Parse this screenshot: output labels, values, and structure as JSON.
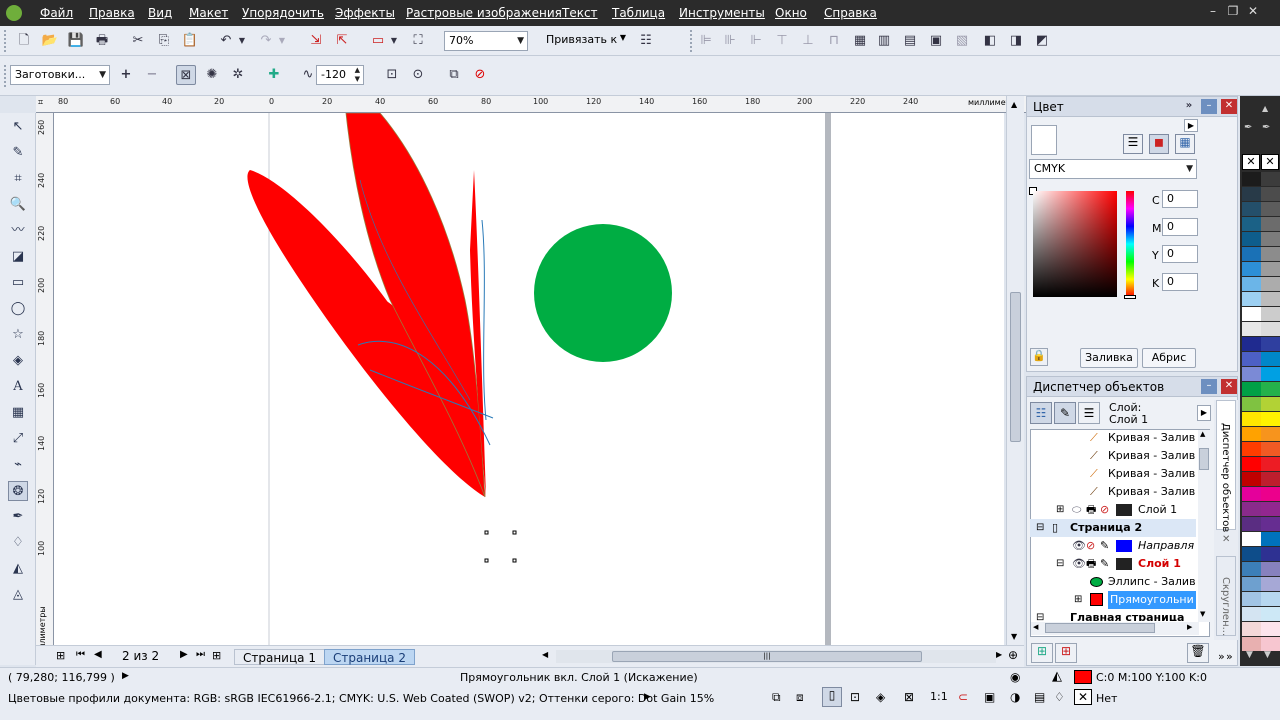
{
  "menu": [
    "Файл",
    "Правка",
    "Вид",
    "Макет",
    "Упорядочить",
    "Эффекты",
    "Растровые изображения",
    "Текст",
    "Таблица",
    "Инструменты",
    "Окно",
    "Справка"
  ],
  "window_controls": {
    "minimize": "–",
    "restore": "❐",
    "close": "✕"
  },
  "toolbar1": {
    "zoom_value": "70%",
    "snap_label": "Привязать к"
  },
  "toolbar2": {
    "presets_label": "Заготовки...",
    "distortion_value": "-120"
  },
  "ruler": {
    "unit": "миллиметры",
    "top_ticks": [
      "80",
      "60",
      "40",
      "20",
      "0",
      "20",
      "40",
      "60",
      "80",
      "100",
      "120",
      "140",
      "160",
      "180",
      "200",
      "220",
      "240"
    ],
    "left_ticks": [
      "260",
      "240",
      "220",
      "200",
      "180",
      "160",
      "140",
      "120",
      "100"
    ]
  },
  "pages": {
    "count_label": "2 из 2",
    "tabs": [
      "Страница 1",
      "Страница 2"
    ],
    "active_tab": 1
  },
  "status": {
    "coords": "( 79,280; 116,799 )",
    "selection": "Прямоугольник вкл. Слой 1  (Искажение)",
    "color_profiles": "Цветовые профили документа: RGB: sRGB IEC61966-2.1; CMYK: U.S. Web Coated (SWOP) v2; Оттенки серого: Dot Gain 15%",
    "fill_info": "C:0 M:100 Y:100 K:0",
    "outline_info": "Нет",
    "fill_color": "#ff0000"
  },
  "color_docker": {
    "title": "Цвет",
    "model": "CMYK",
    "channels": [
      {
        "label": "C",
        "value": "0"
      },
      {
        "label": "M",
        "value": "0"
      },
      {
        "label": "Y",
        "value": "0"
      },
      {
        "label": "K",
        "value": "0"
      }
    ],
    "fill_button": "Заливка",
    "outline_button": "Абрис"
  },
  "object_manager": {
    "title": "Диспетчер объектов",
    "layer_label": "Слой:",
    "layer_name": "Слой 1",
    "rows": [
      {
        "text": "Кривая - Залив",
        "color": "#000",
        "indent": 1
      },
      {
        "text": "Кривая - Залив",
        "color": "#000",
        "indent": 1
      },
      {
        "text": "Кривая - Залив",
        "color": "#000",
        "indent": 1
      },
      {
        "text": "Кривая - Залив",
        "color": "#000",
        "indent": 1
      },
      {
        "text": "Слой 1",
        "color": "#000",
        "indent": 0
      },
      {
        "text": "Страница 2",
        "color": "#000",
        "indent": -1
      },
      {
        "text": "Направля",
        "color": "#000",
        "indent": 0
      },
      {
        "text": "Слой 1",
        "color": "#d40000",
        "indent": 0
      },
      {
        "text": "Эллипс - Залив",
        "color": "#000",
        "indent": 1
      },
      {
        "text": "Прямоугольни",
        "color": "#fff",
        "indent": 1
      },
      {
        "text": "Главная страница",
        "color": "#000",
        "indent": -1
      }
    ],
    "side_tab_1": "Диспетчер объектов",
    "side_tab_2": "Скруглен..."
  },
  "colors": {
    "red": "#ff0000",
    "green": "#00ad43",
    "outline_blue": "#2a7ab8",
    "selection_blue": "#3399ff"
  },
  "palette_col1": [
    "#1c1c1c",
    "#283a48",
    "#244f6a",
    "#1b6186",
    "#0e5d8c",
    "#1a71b6",
    "#2d8fd6",
    "#6bb5e8",
    "#9dd0f2",
    "#ffffff",
    "#e8e8e8",
    "#1f2a8f",
    "#4d60c4",
    "#7b8ad6",
    "#00a046",
    "#7fc241",
    "#ffe600",
    "#ffa200",
    "#ff3d00",
    "#ff0000",
    "#c00000",
    "#e4009b",
    "#8a2b8b",
    "#5a2d82",
    "#ffffff",
    "#0e4d8a",
    "#3c7fb8",
    "#6ea0cf",
    "#a2c4e4",
    "#d4e4f2",
    "#f4d8d8",
    "#e8b0b0"
  ],
  "palette_col2": [
    "#3c3c3c",
    "#4c4c4c",
    "#5c5c5c",
    "#6c6c6c",
    "#7c7c7c",
    "#8c8c8c",
    "#9c9c9c",
    "#acacac",
    "#bcbcbc",
    "#cccccc",
    "#dcdcdc",
    "#2f3f9f",
    "#0087c9",
    "#00a0e3",
    "#25b14b",
    "#b2d235",
    "#fff200",
    "#f7941d",
    "#f15a24",
    "#ed1c24",
    "#be1e2d",
    "#ec008c",
    "#92278f",
    "#662d91",
    "#0072bc",
    "#2e3192",
    "#8781bd",
    "#a6a8d6",
    "#b7d7ef",
    "#cde8f6",
    "#fce4ec",
    "#f7c6d0"
  ]
}
